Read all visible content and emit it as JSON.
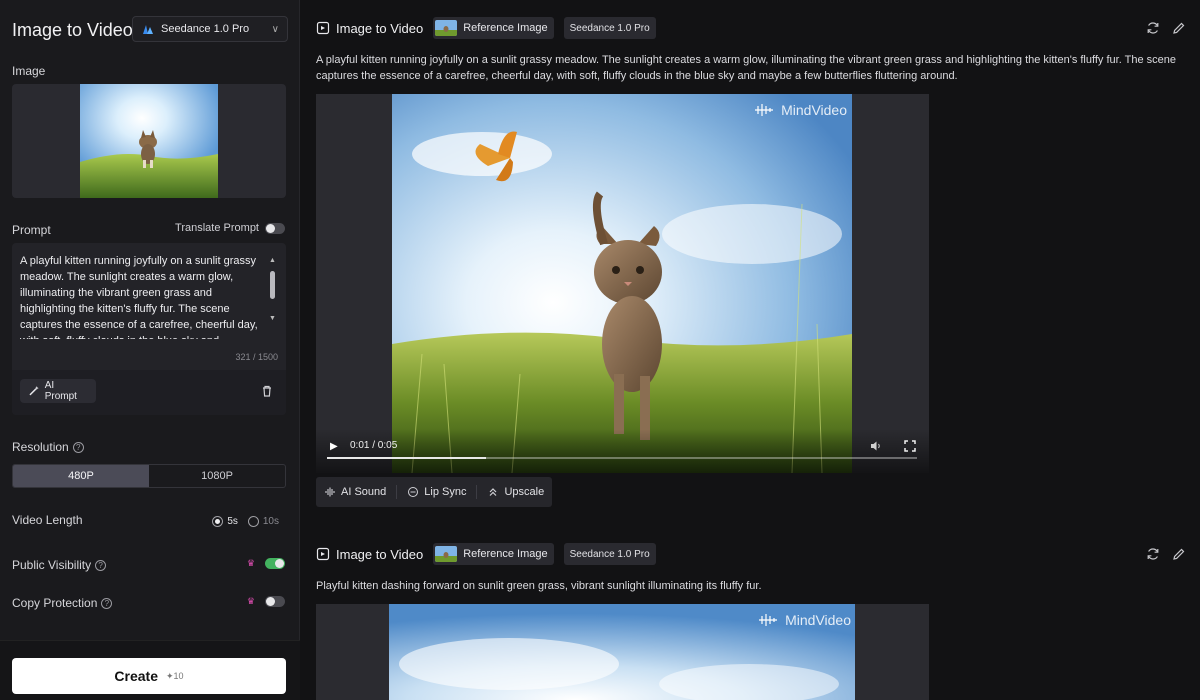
{
  "left": {
    "title": "Image to Video",
    "model": "Seedance 1.0 Pro",
    "image_label": "Image",
    "prompt_label": "Prompt",
    "translate_label": "Translate Prompt",
    "prompt_text": "A playful kitten running joyfully on a sunlit grassy meadow. The sunlight creates a warm glow, illuminating the vibrant green grass and highlighting the kitten's fluffy fur. The scene captures the essence of a carefree, cheerful day, with soft, fluffy clouds in the blue sky and",
    "char_count": "321 / 1500",
    "ai_prompt_label": "AI Prompt",
    "resolution_label": "Resolution",
    "resolutions": [
      "480P",
      "1080P"
    ],
    "resolution_selected": "480P",
    "video_length_label": "Video Length",
    "lengths": [
      "5s",
      "10s"
    ],
    "length_selected": "5s",
    "public_label": "Public Visibility",
    "public_on": true,
    "copy_label": "Copy Protection",
    "copy_on": false,
    "create_label": "Create",
    "create_cost": "✦10"
  },
  "cards": [
    {
      "title": "Image to Video",
      "ref_label": "Reference Image",
      "model": "Seedance 1.0 Pro",
      "description": "A playful kitten running joyfully on a sunlit grassy meadow. The sunlight creates a warm glow, illuminating the vibrant green grass and highlighting the kitten's fluffy fur. The scene captures the essence of a carefree, cheerful day, with soft, fluffy clouds in the blue sky and maybe a few butterflies fluttering around.",
      "watermark": "MindVideo",
      "time": "0:01 / 0:05",
      "progress": 0.27,
      "tools": [
        "AI Sound",
        "Lip Sync",
        "Upscale"
      ]
    },
    {
      "title": "Image to Video",
      "ref_label": "Reference Image",
      "model": "Seedance 1.0 Pro",
      "description": "Playful kitten dashing forward on sunlit green grass, vibrant sunlight illuminating its fluffy fur.",
      "watermark": "MindVideo"
    }
  ],
  "colors": {
    "accent_green": "#43b25f",
    "crown_pink": "#e04eb3"
  }
}
